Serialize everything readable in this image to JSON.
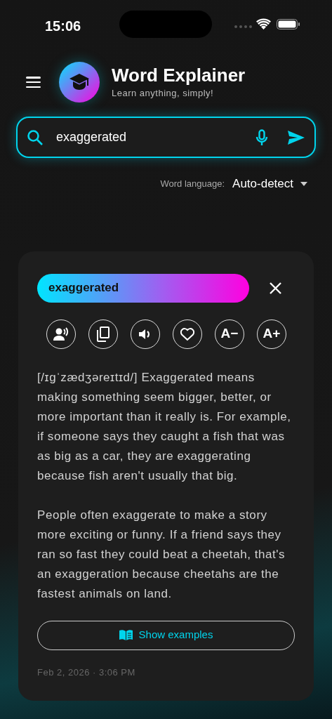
{
  "status_bar": {
    "time": "15:06"
  },
  "header": {
    "title": "Word Explainer",
    "subtitle": "Learn anything, simply!"
  },
  "search": {
    "value": "exaggerated",
    "focused": true
  },
  "language": {
    "label": "Word language:",
    "value": "Auto-detect"
  },
  "result": {
    "word": "exaggerated",
    "actions": [
      {
        "kind": "speak"
      },
      {
        "kind": "copy"
      },
      {
        "kind": "volume"
      },
      {
        "kind": "favorite"
      },
      {
        "kind": "text",
        "label": "A−"
      },
      {
        "kind": "text",
        "label": "A+"
      }
    ],
    "paragraphs": [
      "[/ɪɡˈzædʒəreɪtɪd/] Exaggerated means making something seem bigger, better, or more important than it really is. For example, if someone says they caught a fish that was as big as a car, they are exaggerating because fish aren't usually that big.",
      "People often exaggerate to make a story more exciting or funny. If a friend says they ran so fast they could beat a cheetah, that's an exaggeration because cheetahs are the fastest animals on land."
    ],
    "examples_button": "Show examples",
    "timestamp": "Feb 2, 2026 · 3:06 PM"
  }
}
